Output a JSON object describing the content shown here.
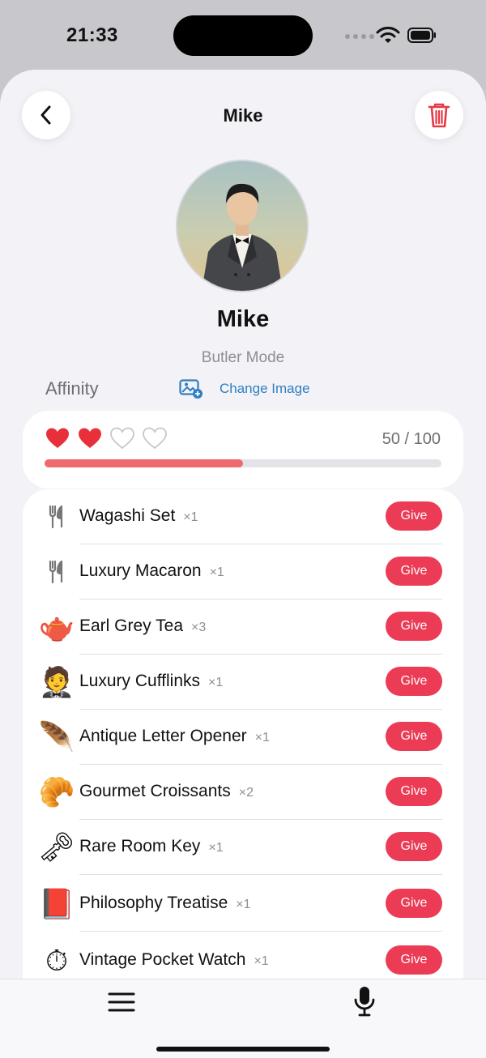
{
  "status_bar": {
    "time": "21:33"
  },
  "nav": {
    "title": "Mike",
    "back_icon": "chevron-left-icon",
    "delete_icon": "trash-icon"
  },
  "profile": {
    "name": "Mike",
    "mode": "Butler Mode",
    "avatar": "man-in-tuxedo-photo"
  },
  "affinity": {
    "label": "Affinity",
    "change_image_label": "Change Image",
    "score_text": "50 / 100",
    "value": 50,
    "max": 100,
    "hearts_filled": 2,
    "hearts_total": 4,
    "heart_color": "#e8303a",
    "bar_color": "#ee6a6e"
  },
  "give_label": "Give",
  "accent_color": "#ec3b55",
  "items": [
    {
      "name": "Wagashi Set",
      "qty": "×1",
      "icon": "fork-knife-icon",
      "glyph": "🍴"
    },
    {
      "name": "Luxury Macaron",
      "qty": "×1",
      "icon": "fork-knife-icon",
      "glyph": "🍴"
    },
    {
      "name": "Earl Grey Tea",
      "qty": "×3",
      "icon": "teapot-icon",
      "glyph": "🫖"
    },
    {
      "name": "Luxury Cufflinks",
      "qty": "×1",
      "icon": "tuxedo-icon",
      "glyph": "🤵"
    },
    {
      "name": "Antique Letter Opener",
      "qty": "×1",
      "icon": "quill-icon",
      "glyph": "🪶"
    },
    {
      "name": "Gourmet Croissants",
      "qty": "×2",
      "icon": "croissant-icon",
      "glyph": "🥐"
    },
    {
      "name": "Rare Room Key",
      "qty": "×1",
      "icon": "key-icon",
      "glyph": "🗝"
    },
    {
      "name": "Philosophy Treatise",
      "qty": "×1",
      "icon": "book-icon",
      "glyph": "📕"
    },
    {
      "name": "Vintage Pocket Watch",
      "qty": "×1",
      "icon": "pocket-watch-icon",
      "glyph": "⏱"
    }
  ],
  "tab_bar": {
    "menu_icon": "menu-icon",
    "mic_icon": "microphone-icon"
  }
}
